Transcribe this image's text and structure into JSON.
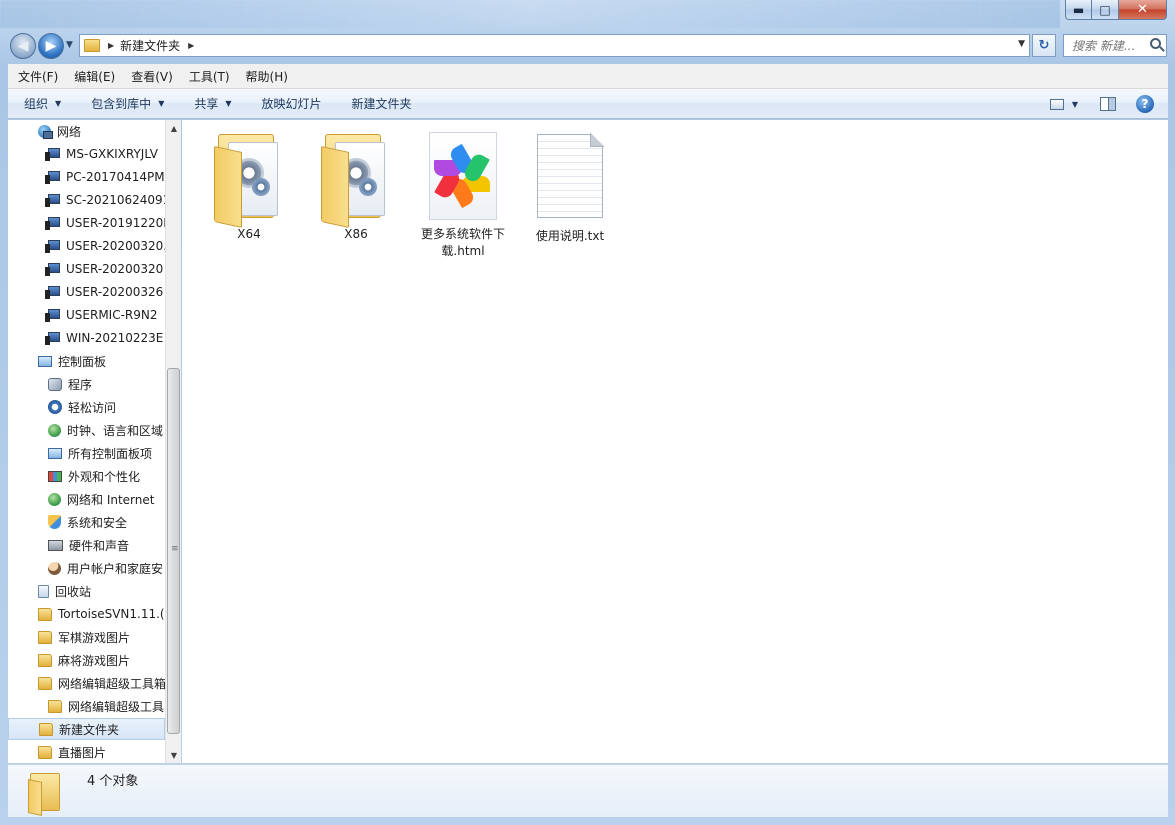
{
  "window": {
    "caption_buttons": {
      "minimize": "▬",
      "maximize": "□",
      "close": "✕"
    }
  },
  "address_bar": {
    "path": [
      "新建文件夹"
    ],
    "search_placeholder": "搜索 新建..."
  },
  "menu": [
    "文件(F)",
    "编辑(E)",
    "查看(V)",
    "工具(T)",
    "帮助(H)"
  ],
  "toolbar": {
    "items": [
      {
        "label": "组织",
        "dropdown": true
      },
      {
        "label": "包含到库中",
        "dropdown": true
      },
      {
        "label": "共享",
        "dropdown": true
      },
      {
        "label": "放映幻灯片",
        "dropdown": false
      },
      {
        "label": "新建文件夹",
        "dropdown": false
      }
    ]
  },
  "nav_tree": [
    {
      "label": "网络",
      "icon": "network-icon",
      "level": 0
    },
    {
      "label": "MS-GXKIXRYJLV",
      "icon": "computer-icon",
      "level": 1
    },
    {
      "label": "PC-20170414PM",
      "icon": "computer-icon",
      "level": 1
    },
    {
      "label": "SC-20210624091",
      "icon": "computer-icon",
      "level": 1
    },
    {
      "label": "USER-20191220I",
      "icon": "computer-icon",
      "level": 1
    },
    {
      "label": "USER-20200320.",
      "icon": "computer-icon",
      "level": 1
    },
    {
      "label": "USER-20200320",
      "icon": "computer-icon",
      "level": 1
    },
    {
      "label": "USER-20200326",
      "icon": "computer-icon",
      "level": 1
    },
    {
      "label": "USERMIC-R9N2",
      "icon": "computer-icon",
      "level": 1
    },
    {
      "label": "WIN-20210223E",
      "icon": "computer-icon",
      "level": 1
    },
    {
      "label": "控制面板",
      "icon": "control-panel-icon",
      "level": 0
    },
    {
      "label": "程序",
      "icon": "programs-icon",
      "level": 1
    },
    {
      "label": "轻松访问",
      "icon": "ease-of-access-icon",
      "level": 1
    },
    {
      "label": "时钟、语言和区域",
      "icon": "clock-language-region-icon",
      "level": 1
    },
    {
      "label": "所有控制面板项",
      "icon": "all-control-panel-items-icon",
      "level": 1
    },
    {
      "label": "外观和个性化",
      "icon": "appearance-icon",
      "level": 1
    },
    {
      "label": "网络和 Internet",
      "icon": "network-internet-icon",
      "level": 1
    },
    {
      "label": "系统和安全",
      "icon": "system-security-icon",
      "level": 1
    },
    {
      "label": "硬件和声音",
      "icon": "hardware-sound-icon",
      "level": 1
    },
    {
      "label": "用户帐户和家庭安",
      "icon": "user-accounts-icon",
      "level": 1
    },
    {
      "label": "回收站",
      "icon": "recycle-bin-icon",
      "level": 0
    },
    {
      "label": "TortoiseSVN1.11.(",
      "icon": "folder-icon",
      "level": 0
    },
    {
      "label": "军棋游戏图片",
      "icon": "folder-icon",
      "level": 0
    },
    {
      "label": "麻将游戏图片",
      "icon": "folder-icon",
      "level": 0
    },
    {
      "label": "网络编辑超级工具箱",
      "icon": "folder-icon",
      "level": 0
    },
    {
      "label": "网络编辑超级工具",
      "icon": "folder-icon",
      "level": 1
    },
    {
      "label": "新建文件夹",
      "icon": "folder-icon",
      "level": 0,
      "selected": true
    },
    {
      "label": "直播图片",
      "icon": "folder-icon",
      "level": 0
    }
  ],
  "files": [
    {
      "name": "X64",
      "type": "settings-folder"
    },
    {
      "name": "X86",
      "type": "settings-folder"
    },
    {
      "name": "更多系统软件下载.html",
      "type": "html"
    },
    {
      "name": "使用说明.txt",
      "type": "txt"
    }
  ],
  "details": {
    "count_text": "4 个对象"
  },
  "colors": {
    "accent": "#1e395b",
    "selection": "#d5e5f7",
    "frame": "#a9c6e6"
  }
}
